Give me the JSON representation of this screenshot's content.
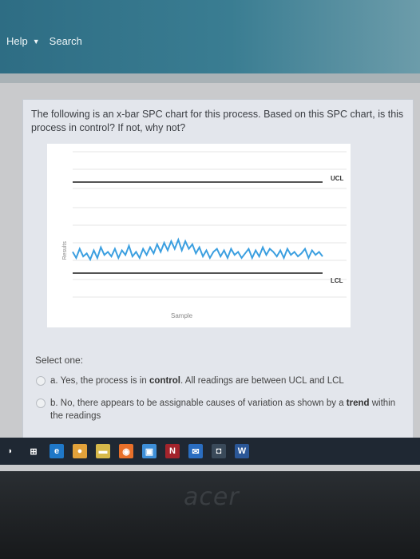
{
  "nav": {
    "help_label": "Help",
    "search_label": "Search"
  },
  "question": {
    "text": "The following is an x-bar SPC chart for this process. Based on this SPC chart, is this process in control? If not, why not?"
  },
  "chart_data": {
    "type": "line",
    "xlabel": "Sample",
    "ylabel": "Results",
    "reference_lines": [
      {
        "label": "UCL",
        "value": 8
      },
      {
        "label": "LCL",
        "value": 2
      }
    ],
    "ylim": [
      0,
      10
    ],
    "grid": true,
    "series": [
      {
        "values": [
          3.4,
          3.0,
          3.6,
          3.1,
          3.3,
          2.9,
          3.5,
          3.0,
          3.7,
          3.2,
          3.4,
          3.1,
          3.6,
          3.0,
          3.5,
          3.2,
          3.8,
          3.1,
          3.4,
          3.0,
          3.6,
          3.2,
          3.7,
          3.3,
          3.9,
          3.4,
          4.0,
          3.5,
          4.1,
          3.6,
          4.2,
          3.5,
          4.1,
          3.6,
          3.9,
          3.3,
          3.7,
          3.1,
          3.5,
          3.0,
          3.4,
          3.6,
          3.1,
          3.5,
          3.0,
          3.6,
          3.2,
          3.4,
          3.0,
          3.3,
          3.6,
          3.0,
          3.5,
          3.1,
          3.7,
          3.2,
          3.6,
          3.4,
          3.1,
          3.5,
          3.0,
          3.6,
          3.2,
          3.4,
          3.1,
          3.3,
          3.6,
          3.0,
          3.5,
          3.2,
          3.4,
          3.1
        ]
      }
    ]
  },
  "form": {
    "select_label": "Select one:",
    "option_a": {
      "prefix": "a. Yes, the process is in ",
      "bold": "control",
      "suffix": ". All readings are between UCL and LCL"
    },
    "option_b": {
      "prefix": "b. No, there appears to be assignable causes of variation as shown by a ",
      "bold": "trend",
      "suffix": " within the readings"
    }
  },
  "taskbar": {
    "icons": [
      {
        "name": "task-view-icon",
        "color": "#1f2833",
        "glyph": "⊞"
      },
      {
        "name": "edge-icon",
        "color": "#1f78c8",
        "glyph": "e"
      },
      {
        "name": "chrome-icon",
        "color": "#e2a23a",
        "glyph": "●"
      },
      {
        "name": "file-explorer-icon",
        "color": "#d7b94a",
        "glyph": "▬"
      },
      {
        "name": "firefox-icon",
        "color": "#e8702a",
        "glyph": "◉"
      },
      {
        "name": "photos-icon",
        "color": "#3e8fd8",
        "glyph": "▣"
      },
      {
        "name": "onenote-icon",
        "color": "#a3242c",
        "glyph": "N"
      },
      {
        "name": "mail-icon",
        "color": "#2a6dc0",
        "glyph": "✉"
      },
      {
        "name": "camera-icon",
        "color": "#3a4a5a",
        "glyph": "◘"
      },
      {
        "name": "word-icon",
        "color": "#2b5797",
        "glyph": "W"
      }
    ]
  },
  "device": {
    "brand": "acer"
  }
}
